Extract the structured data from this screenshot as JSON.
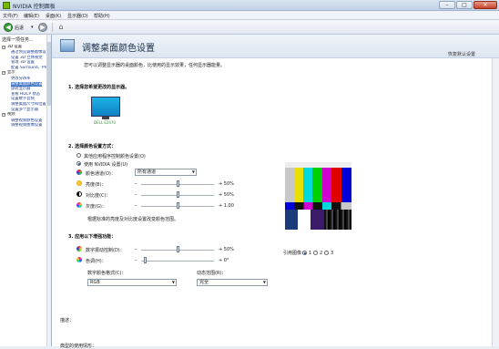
{
  "window": {
    "title": "NVIDIA 控制面板",
    "min": "–",
    "max": "□",
    "close": "✕"
  },
  "menu": [
    {
      "label": "文件(F)"
    },
    {
      "label": "编辑(E)"
    },
    {
      "label": "桌面(K)"
    },
    {
      "label": "显示器(D)"
    },
    {
      "label": "帮助(H)"
    }
  ],
  "toolbar": {
    "back_label": "后退",
    "back_dd": "▾",
    "back_icon": "◀",
    "forward_icon": "▶",
    "home_icon": "⌂"
  },
  "sidebar": {
    "header": "选择一项任务...",
    "tree": [
      {
        "label": "3D 设置",
        "cat": true,
        "exp": "−"
      },
      {
        "label": "通过预览调整图像设置"
      },
      {
        "label": "设置 3D 立体视觉"
      },
      {
        "label": "管理 3D 设置"
      },
      {
        "label": "配置 Surround、PhysX"
      },
      {
        "label": "显示",
        "cat": true,
        "exp": "−"
      },
      {
        "label": "更改分辨率"
      },
      {
        "label": "调整桌面颜色设置",
        "selected": true
      },
      {
        "label": "旋转显示器"
      },
      {
        "label": "查看 HDCP 状态"
      },
      {
        "label": "设置数字音频"
      },
      {
        "label": "调整桌面尺寸和位置"
      },
      {
        "label": "设置多个显示器"
      },
      {
        "label": "视频",
        "cat": true,
        "exp": "−"
      },
      {
        "label": "调整视频颜色设置"
      },
      {
        "label": "调整视频图像设置"
      }
    ]
  },
  "page": {
    "title": "调整桌面颜色设置",
    "restore": "恢复默认设置",
    "description": "您可以调整显示器的桌面颜色，比使用的显示效果，任何显示器能量。"
  },
  "section1": {
    "title": "1.  选择您希望更改的显示器。",
    "monitor_label": "DELL E2470"
  },
  "section2": {
    "title": "2.  选择颜色设置方式：",
    "radio_other": "其他应用程序控制颜色设置(O)",
    "radio_nvidia": "使用 NVIDIA 设置(U)",
    "channel_label": "颜色通道(O)：",
    "channel_value": "所有通道",
    "brightness_label": "亮度(B)：",
    "brightness_value": "+ 50%",
    "contrast_label": "对比度(C)：",
    "contrast_value": "+ 50%",
    "gamma_label": "灰度(G)：",
    "gamma_value": "+ 1.00",
    "hint": "根据标准的亮度及对比度设置改变颜色范围。",
    "brightness_level": 0.5,
    "contrast_level": 0.5,
    "gamma_level": 0.5
  },
  "section3": {
    "title": "3.  应用以下增强功能：",
    "vibrance_label": "数字振动控制(D)：",
    "vibrance_value": "+ 50%",
    "hue_label": "色调(H)：",
    "hue_value": "+ 0°",
    "color_format_label": "数字颜色格式(C)：",
    "color_format_value": "RGB",
    "dynamic_range_label": "动态范围(R)：",
    "dynamic_range_value": "完全",
    "reference_label": "引用图像：",
    "ref_options": [
      "1",
      "2",
      "3"
    ],
    "vibrance_level": 0.5,
    "hue_level": 0.0
  },
  "footer": {
    "notes": "描述：",
    "typical": "典型的使用情形："
  },
  "colors": {
    "accent": "#3a6fc4",
    "nvidia_green": "#78b900"
  }
}
